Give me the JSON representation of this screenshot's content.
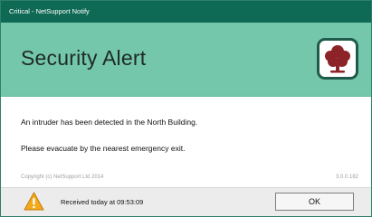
{
  "window": {
    "title": "Critical - NetSupport Notify"
  },
  "banner": {
    "title": "Security Alert",
    "logo_icon": "oak-tree-icon"
  },
  "messages": [
    "An intruder has been detected in the North Building.",
    "Please evacuate by the nearest emergency exit."
  ],
  "footer": {
    "copyright": "Copyright (c) NetSupport Ltd 2014",
    "version": "3.0.0.182"
  },
  "status": {
    "received": "Received today at 09:53:09",
    "warning_icon": "warning-icon"
  },
  "actions": {
    "ok_label": "OK"
  },
  "colors": {
    "titlebar": "#0f6a55",
    "banner": "#74c7ab",
    "logo_tree": "#8b2328",
    "warning": "#f4a81c"
  }
}
